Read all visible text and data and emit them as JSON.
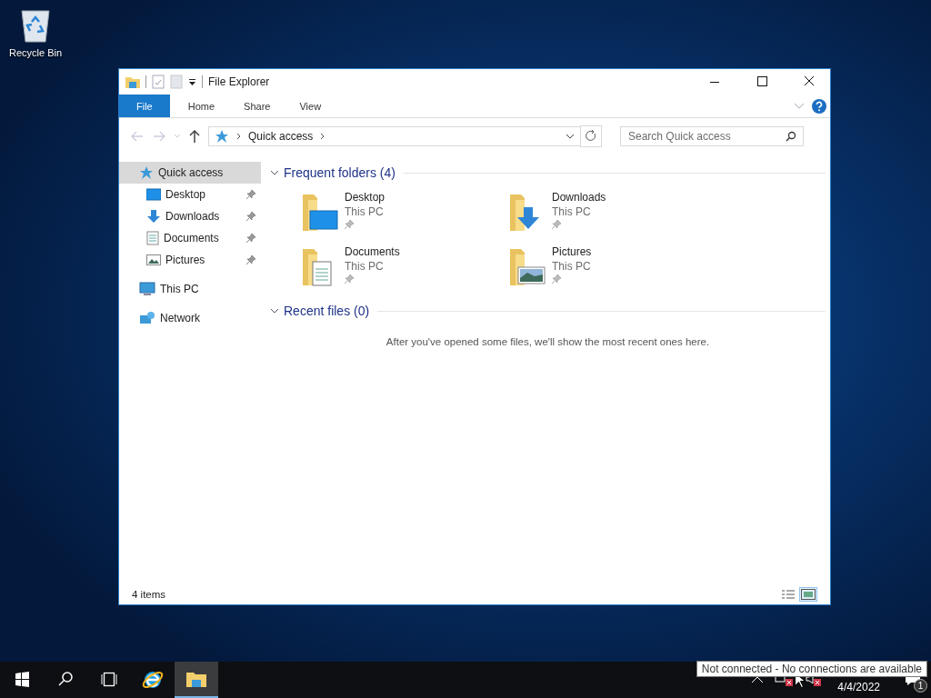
{
  "desktop": {
    "icons": [
      {
        "label": "Recycle Bin"
      }
    ]
  },
  "window": {
    "title": "File Explorer",
    "ribbon_tabs": [
      {
        "label": "File",
        "kind": "file"
      },
      {
        "label": "Home",
        "kind": "tab"
      },
      {
        "label": "Share",
        "kind": "tab"
      },
      {
        "label": "View",
        "kind": "tab"
      }
    ],
    "address": {
      "path": "Quick access"
    },
    "search": {
      "placeholder": "Search Quick access"
    },
    "nav": [
      {
        "label": "Quick access",
        "kind": "star",
        "selected": true,
        "children": [
          {
            "label": "Desktop",
            "kind": "desktop",
            "pinned": true,
            "selected": false
          },
          {
            "label": "Downloads",
            "kind": "downloads",
            "pinned": true,
            "selected": false
          },
          {
            "label": "Documents",
            "kind": "documents",
            "pinned": true,
            "selected": false
          },
          {
            "label": "Pictures",
            "kind": "pictures",
            "pinned": true,
            "selected": false
          }
        ]
      },
      {
        "label": "This PC",
        "kind": "pc",
        "selected": false
      },
      {
        "label": "Network",
        "kind": "network",
        "selected": false
      }
    ],
    "sections": [
      {
        "title": "Frequent folders (4)",
        "expanded": true,
        "folders": [
          {
            "name": "Desktop",
            "location": "This PC",
            "kind": "desktop",
            "pinned": true
          },
          {
            "name": "Downloads",
            "location": "This PC",
            "kind": "downloads",
            "pinned": true
          },
          {
            "name": "Documents",
            "location": "This PC",
            "kind": "documents",
            "pinned": true
          },
          {
            "name": "Pictures",
            "location": "This PC",
            "kind": "pictures",
            "pinned": true
          }
        ]
      },
      {
        "title": "Recent files (0)",
        "expanded": true,
        "message": "After you've opened some files, we'll show the most recent ones here."
      }
    ],
    "status_bar": {
      "count": "4 items"
    }
  },
  "taskbar": {
    "apps": [
      {
        "kind": "ie",
        "active": false
      },
      {
        "kind": "explorer",
        "active": true
      }
    ],
    "tooltip": "Not connected - No connections are available",
    "date": "4/4/2022",
    "notification_count": "1"
  }
}
